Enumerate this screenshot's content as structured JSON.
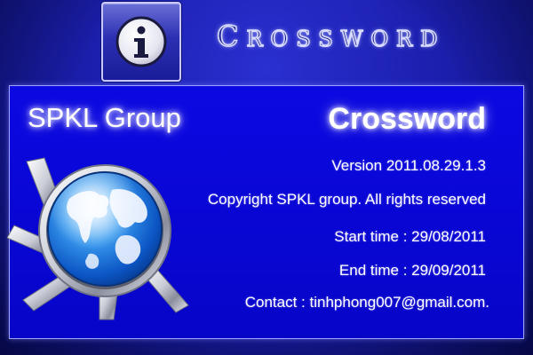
{
  "header": {
    "icon": "info-icon",
    "title_first": "C",
    "title_rest": "ROSSWORD"
  },
  "panel": {
    "company": "SPKL Group",
    "product": "Crossword",
    "version": "Version 2011.08.29.1.3",
    "copyright": "Copyright SPKL group. All rights reserved",
    "start_time": "Start time : 29/08/2011",
    "end_time": "End time : 29/09/2011",
    "contact": "Contact : tinhphong007@gmail.com.",
    "logo_icon": "globe-gear-icon"
  },
  "colors": {
    "background": "#1b1fae",
    "panel": "#0906d9",
    "panel_border": "#9ea4ff",
    "text": "#ffffff"
  }
}
